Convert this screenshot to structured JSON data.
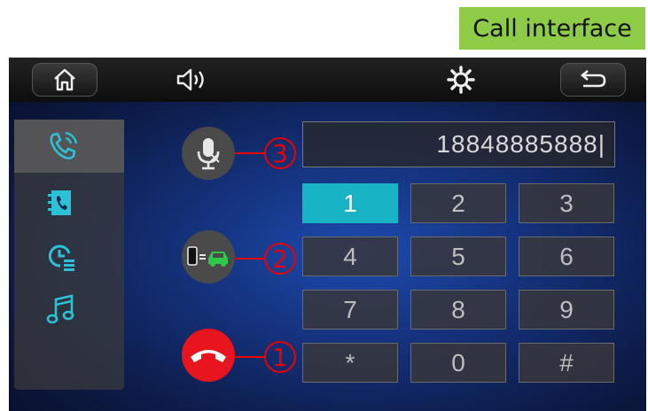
{
  "caption": "Call interface",
  "topbar": {
    "icons": [
      "home-icon",
      "volume-icon",
      "settings-icon",
      "back-icon"
    ]
  },
  "sidebar": {
    "items": [
      {
        "icon": "dialer-phone-icon",
        "active": true
      },
      {
        "icon": "contacts-book-icon",
        "active": false
      },
      {
        "icon": "call-history-icon",
        "active": false
      },
      {
        "icon": "music-note-icon",
        "active": false
      }
    ]
  },
  "actions": [
    {
      "icon": "mic-mute-icon",
      "callout": "3"
    },
    {
      "icon": "phone-car-switch-icon",
      "callout": "2"
    },
    {
      "icon": "hang-up-icon",
      "callout": "1"
    }
  ],
  "dial": {
    "number": "18848885888|",
    "keys": [
      "1",
      "2",
      "3",
      "4",
      "5",
      "6",
      "7",
      "8",
      "9",
      "*",
      "0",
      "#"
    ],
    "active_key": "1"
  },
  "colors": {
    "accent": "#19b3c6",
    "hangup": "#e8141e",
    "callout": "#e00000",
    "caption_bg": "#8ecb47"
  }
}
